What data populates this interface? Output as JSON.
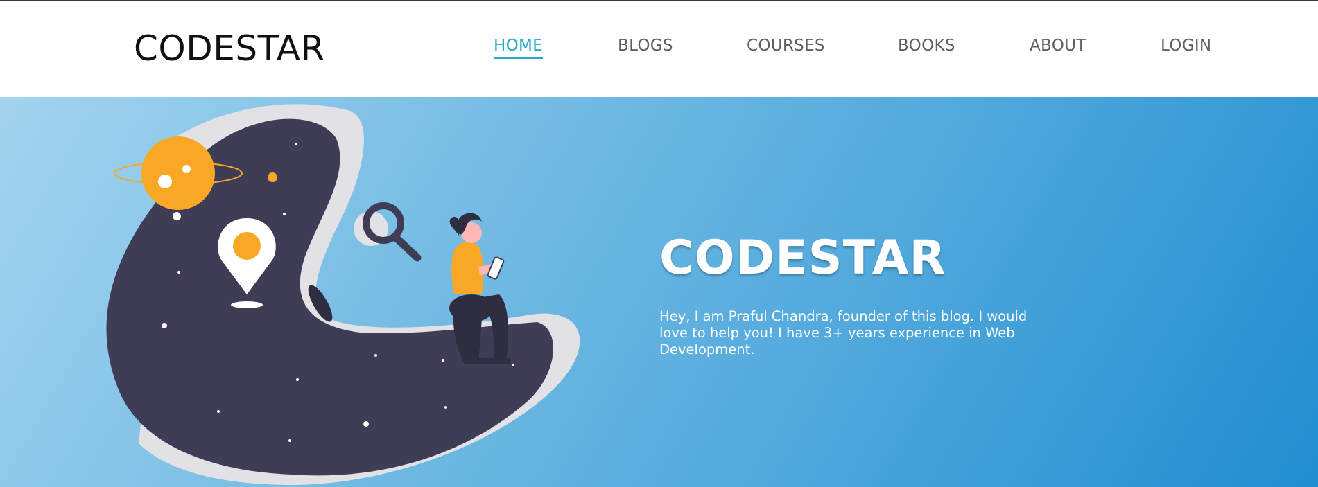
{
  "header": {
    "brand": "CODESTAR",
    "nav": [
      {
        "label": "HOME",
        "active": true
      },
      {
        "label": "BLOGS",
        "active": false
      },
      {
        "label": "COURSES",
        "active": false
      },
      {
        "label": "BOOKS",
        "active": false
      },
      {
        "label": "ABOUT",
        "active": false
      },
      {
        "label": "LOGIN",
        "active": false
      }
    ]
  },
  "hero": {
    "title": "CODESTAR",
    "description": "Hey, I am Praful Chandra, founder of this blog. I would love to help you! I have 3+ years experience in Web Development.",
    "illustration_icons": [
      "planet-icon",
      "location-pin-icon",
      "magnifier-icon",
      "person-with-phone-icon",
      "star-dots"
    ]
  },
  "colors": {
    "accent": "#2aa8c8",
    "nav_text": "#5f5f5f",
    "blob": "#3f3d56",
    "planet": "#f9a826",
    "hero_gradient_start": "#a3d3ef",
    "hero_gradient_end": "#218dd0"
  }
}
